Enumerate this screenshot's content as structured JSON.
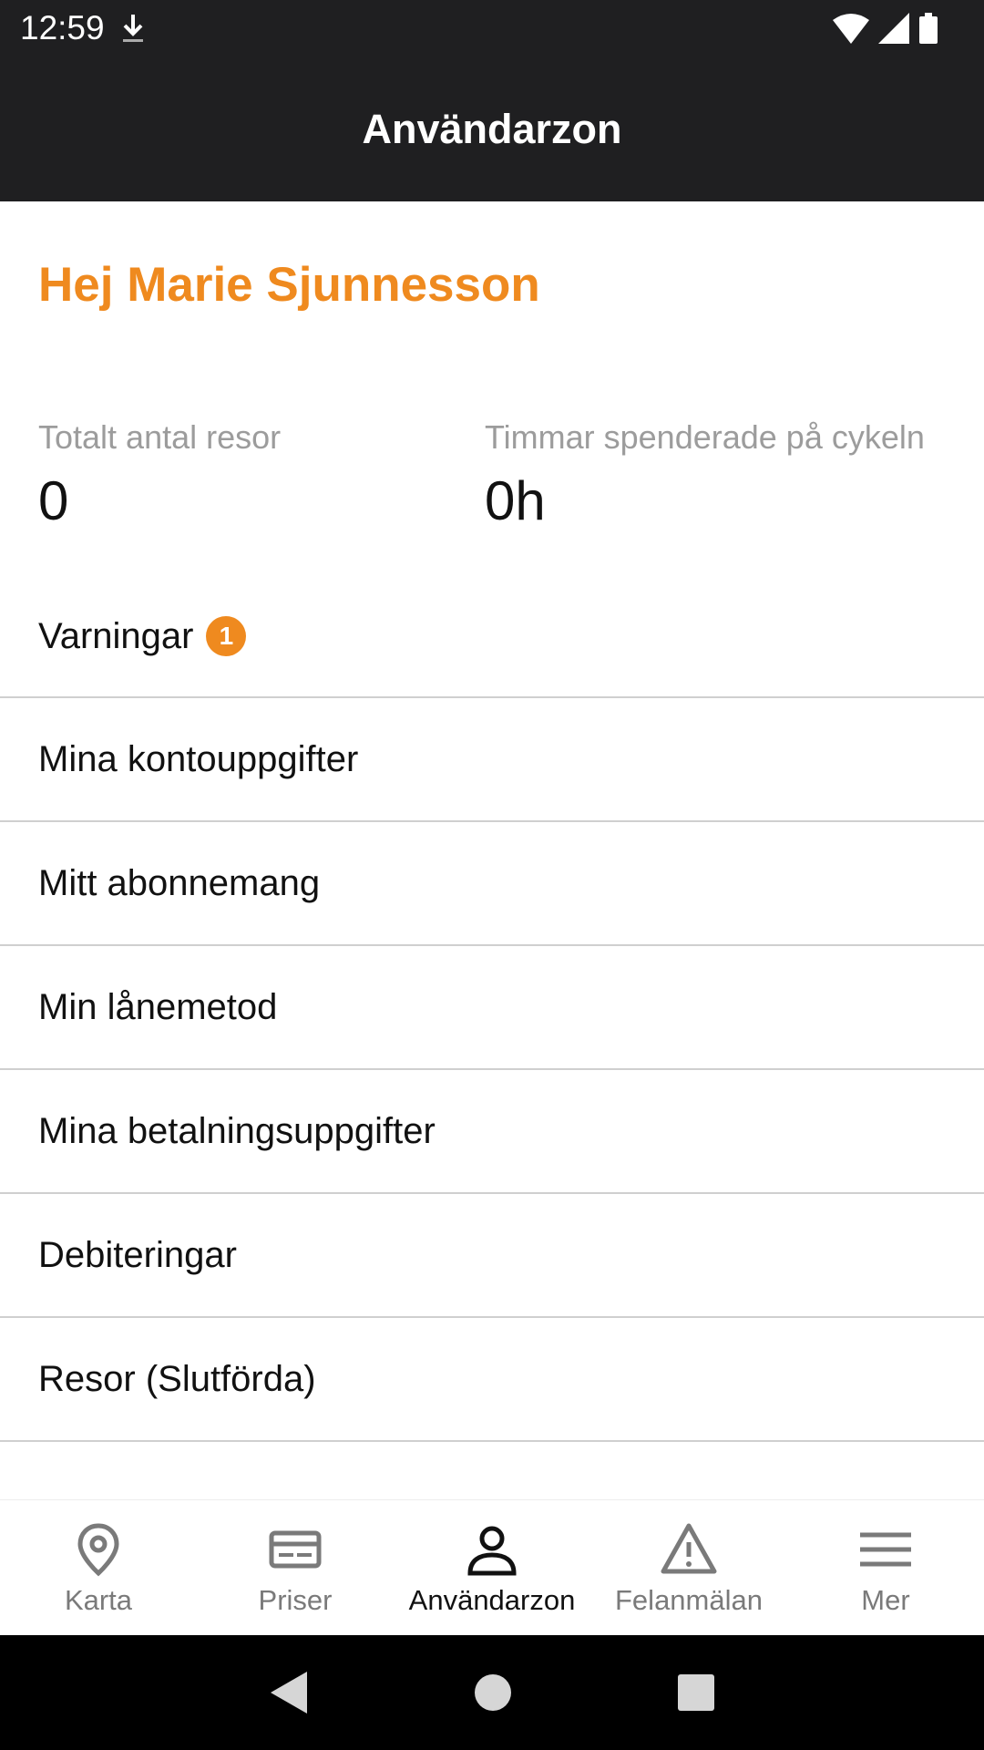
{
  "status_bar": {
    "time": "12:59"
  },
  "app_bar": {
    "title": "Användarzon"
  },
  "greeting": "Hej Marie Sjunnesson",
  "stats": {
    "trips": {
      "label": "Totalt antal resor",
      "value": "0"
    },
    "hours": {
      "label": "Timmar spenderade på cykeln",
      "value": "0h"
    }
  },
  "menu": [
    {
      "label": "Varningar",
      "badge": "1"
    },
    {
      "label": "Mina kontouppgifter"
    },
    {
      "label": "Mitt abonnemang"
    },
    {
      "label": "Min lånemetod"
    },
    {
      "label": "Mina betalningsuppgifter"
    },
    {
      "label": "Debiteringar"
    },
    {
      "label": "Resor (Slutförda)"
    }
  ],
  "bottom_nav": [
    {
      "label": "Karta",
      "icon": "location-pin-icon"
    },
    {
      "label": "Priser",
      "icon": "card-icon"
    },
    {
      "label": "Användarzon",
      "icon": "person-icon",
      "active": true
    },
    {
      "label": "Felanmälan",
      "icon": "warning-icon"
    },
    {
      "label": "Mer",
      "icon": "menu-icon"
    }
  ],
  "colors": {
    "accent": "#ef8a1f",
    "header": "#1f1f21"
  }
}
